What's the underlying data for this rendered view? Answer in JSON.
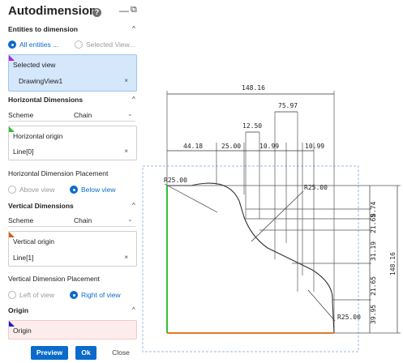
{
  "panel": {
    "title": "Autodimension",
    "help_glyph": "?",
    "minimize_glyph": "—",
    "restore_glyph": "⧉",
    "entities": {
      "heading": "Entities to dimension",
      "option_all": "All entities ...",
      "option_selected": "Selected View...",
      "selected_value": "all"
    },
    "selected_view": {
      "label": "Selected view",
      "value": "DrawingView1",
      "flag_color": "#b323d6"
    },
    "horizontal": {
      "heading": "Horizontal Dimensions",
      "scheme_label": "Scheme",
      "scheme_value": "Chain",
      "origin_label": "Horizontal origin",
      "origin_value": "Line[0]",
      "origin_flag_color": "#2fc22f",
      "placement_label": "Horizontal Dimension Placement",
      "option_above": "Above view",
      "option_below": "Below view",
      "selected_value": "below"
    },
    "vertical": {
      "heading": "Vertical Dimensions",
      "scheme_label": "Scheme",
      "scheme_value": "Chain",
      "origin_label": "Vertical origin",
      "origin_value": "Line[1]",
      "origin_flag_color": "#d1621b",
      "placement_label": "Vertical Dimension Placement",
      "option_left": "Left of view",
      "option_right": "Right of view",
      "selected_value": "right"
    },
    "origin": {
      "heading": "Origin",
      "field_label": "Origin",
      "flag_color": "#1a1adb"
    },
    "clear_glyph": "×",
    "caret_glyph": "^",
    "chevron_glyph": "⌄",
    "buttons": {
      "preview": "Preview",
      "ok": "Ok",
      "close": "Close"
    },
    "accent_color": "#0b6bcb"
  },
  "drawing": {
    "horizontal_dims": {
      "overall": "148.16",
      "d1": "75.97",
      "d2": "12.50",
      "d3": "44.18",
      "d4": "25.00",
      "d5": "10.99",
      "d6": "10.99"
    },
    "vertical_dims": {
      "overall": "148.16",
      "d1": "21.65",
      "d2": "8.74",
      "d3": "31.19",
      "d4": "21.65",
      "d5": "39.95"
    },
    "radius_labels": {
      "top_left": "R25.00",
      "top_right": "R25.00",
      "bottom_right": "R25.00"
    },
    "origin_horizontal_color": "#2fc22f",
    "origin_vertical_color": "#e07a2a",
    "selection_color": "#9db9ea"
  }
}
